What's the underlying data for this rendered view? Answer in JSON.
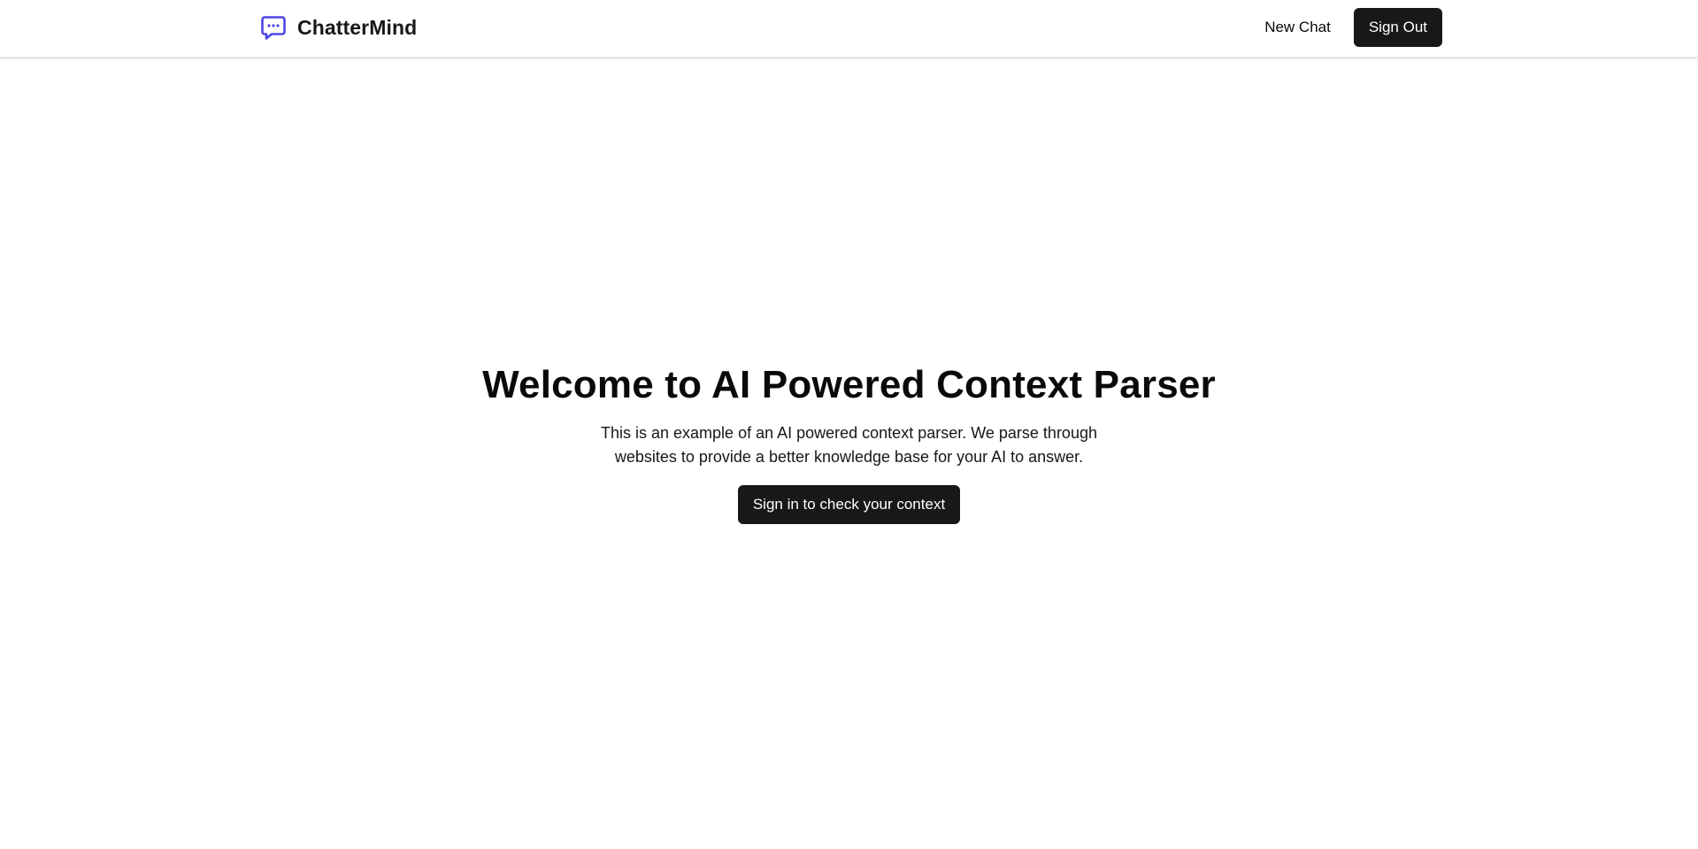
{
  "header": {
    "brand_name": "ChatterMind",
    "brand_icon": "chat-bubble-dots-icon",
    "brand_color": "#4f46e5",
    "nav": {
      "new_chat_label": "New Chat",
      "sign_out_label": "Sign Out"
    }
  },
  "hero": {
    "title": "Welcome to AI Powered Context Parser",
    "description": "This is an example of an AI powered context parser. We parse through websites to provide a better knowledge base for your AI to answer.",
    "cta_label": "Sign in to check your context"
  },
  "colors": {
    "button_bg": "#18181b",
    "button_text": "#ffffff",
    "text": "#0a0a0a",
    "background": "#ffffff"
  }
}
